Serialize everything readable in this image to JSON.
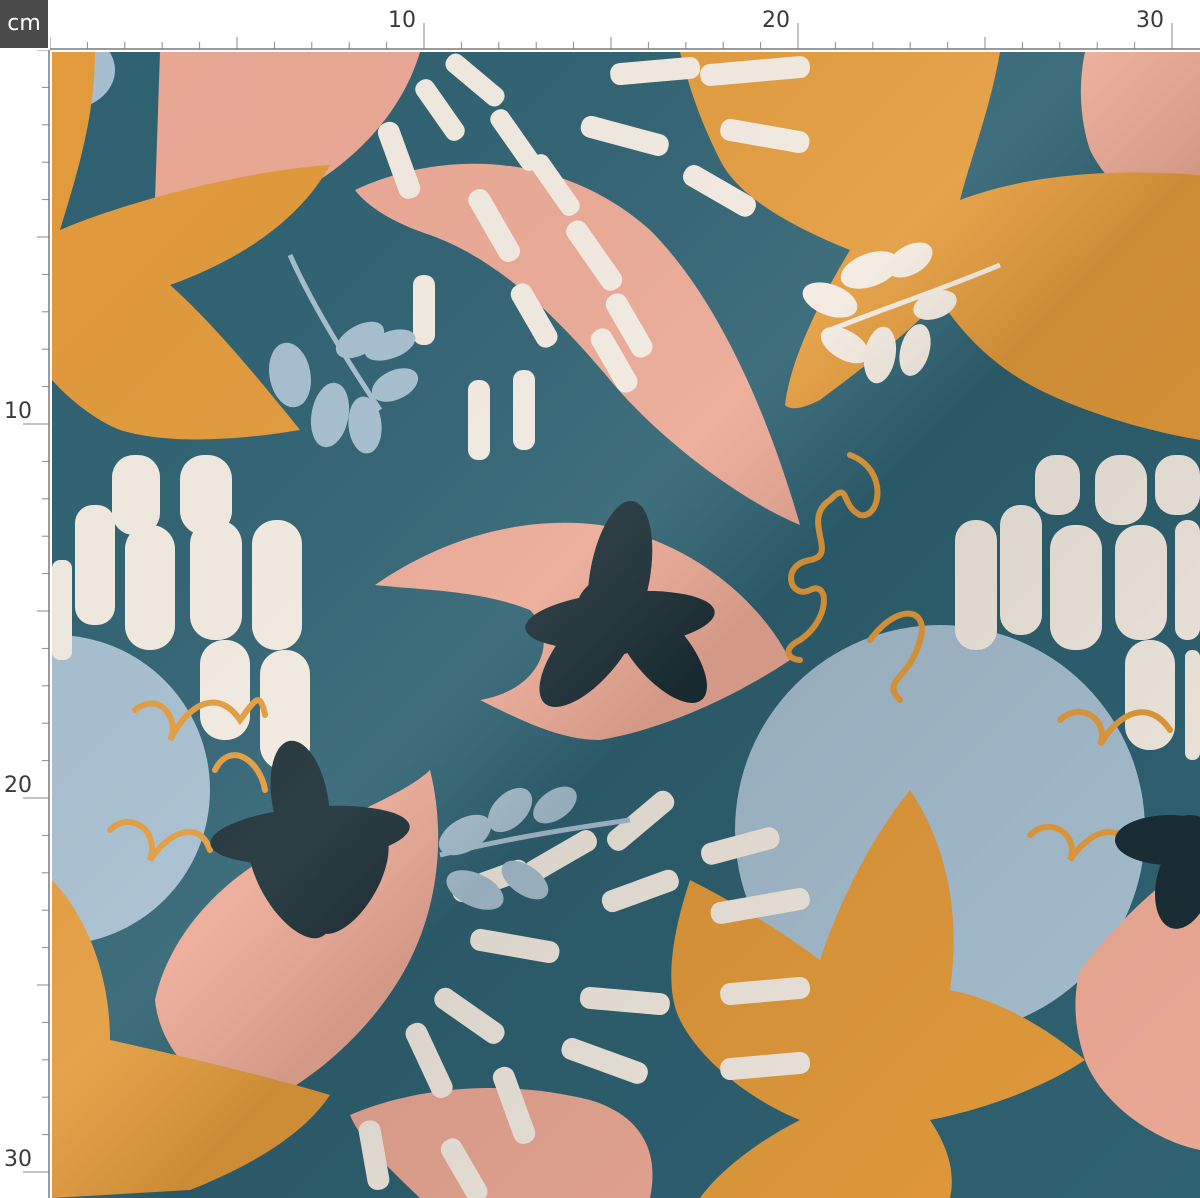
{
  "unit_label": "cm",
  "ruler_top_labels": [
    "10",
    "20",
    "30"
  ],
  "ruler_left_labels": [
    "10",
    "20",
    "30"
  ],
  "colors": {
    "background": "#2f6272",
    "orange": "#e39b3c",
    "pink": "#eba995",
    "light_blue": "#a7bfd0",
    "cream": "#f3ebe1",
    "dark_flower": "#1b2e35",
    "ruler_line": "#8a8a8a",
    "badge": "#4a4a4a"
  }
}
